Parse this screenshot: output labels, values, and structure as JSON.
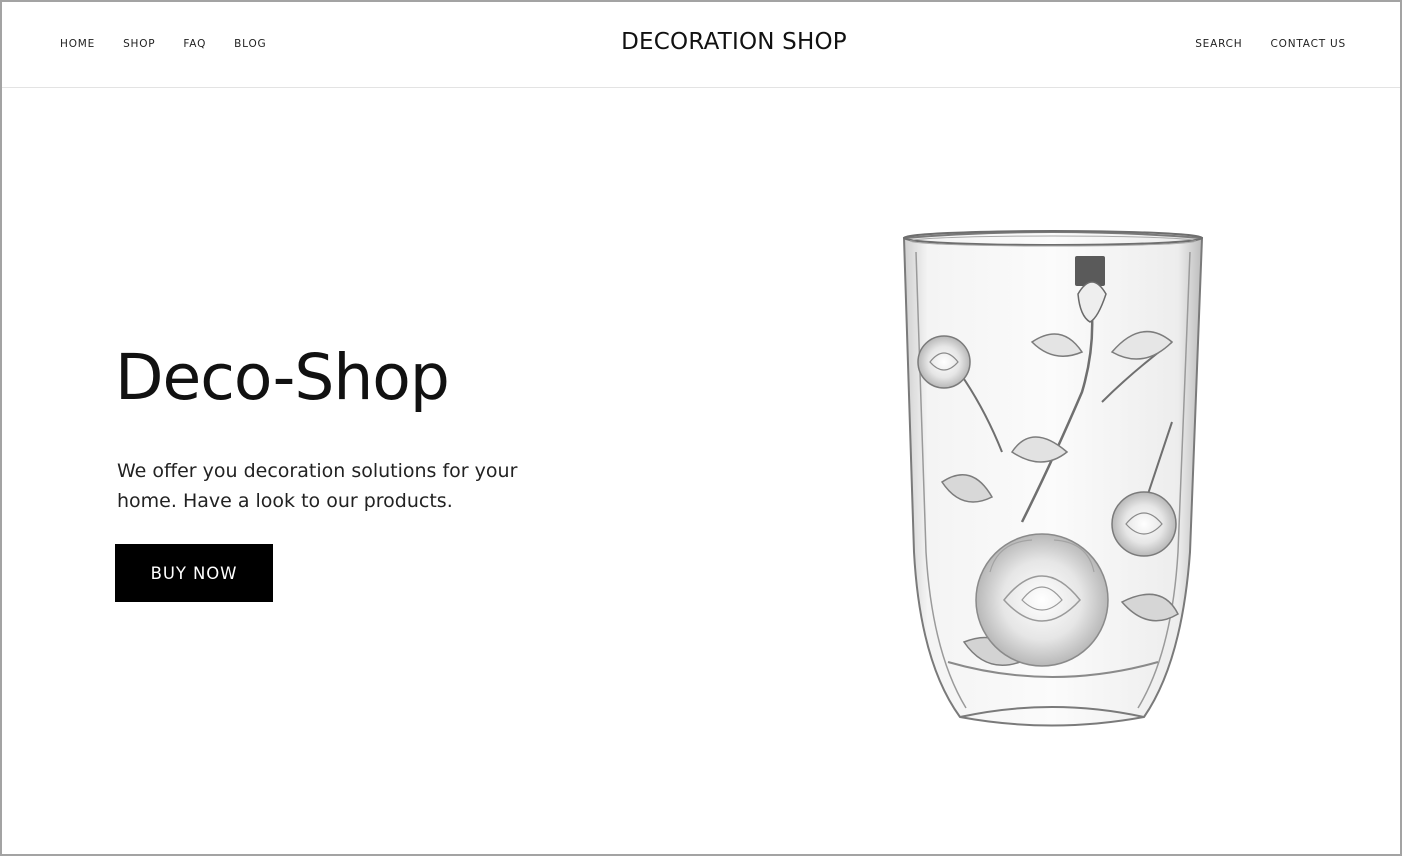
{
  "header": {
    "nav_left": [
      "HOME",
      "SHOP",
      "FAQ",
      "BLOG"
    ],
    "brand": "DECORATION SHOP",
    "nav_right": [
      "SEARCH",
      "CONTACT US"
    ]
  },
  "hero": {
    "title": "Deco-Shop",
    "description": "We offer you decoration solutions for your home. Have a look to our products.",
    "button_label": "BUY NOW"
  },
  "product_image": {
    "subject": "glass-vase-with-rose-engraving"
  }
}
